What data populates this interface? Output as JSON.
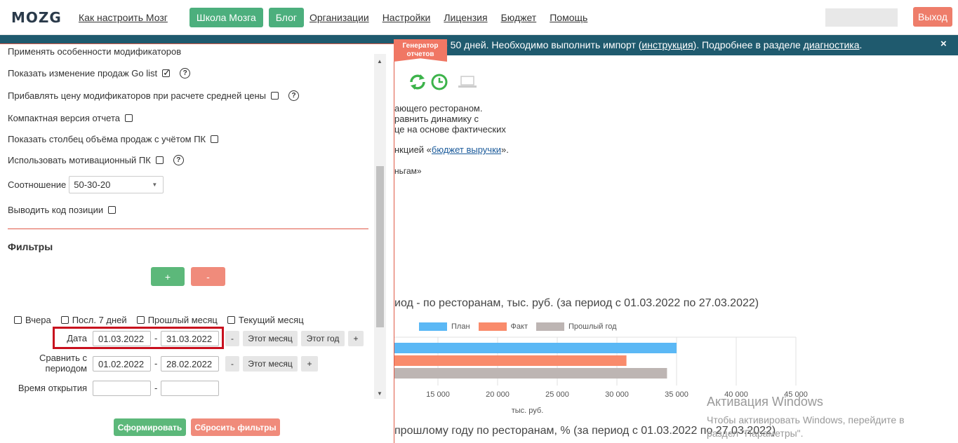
{
  "header": {
    "logo": "MOZG",
    "nav_how": "Как настроить Мозг",
    "school": "Школа Мозга",
    "blog": "Блог",
    "links": [
      "Организации",
      "Настройки",
      "Лицензия",
      "Бюджет",
      "Помощь"
    ],
    "logout": "Выход"
  },
  "banner": {
    "pre": "ё 50 дней. Необходимо выполнить импорт (",
    "link1": "инструкция",
    "mid": "). Подробнее в разделе ",
    "link2": "диагностика",
    "post": ".",
    "close": "×"
  },
  "ribbon": {
    "line1": "Генератор",
    "line2": "отчетов"
  },
  "background": {
    "desc1": "ающего рестораном.",
    "desc2": "равнить динамику с",
    "desc3": "це на основе фактических",
    "desc4_pre": "нкцией «",
    "desc4_link": "бюджет выручки",
    "desc4_post": "».",
    "desc5": "ньгам»",
    "chart_title": "иод - по ресторанам, тыс. руб. (за период с 01.03.2022 по 27.03.2022)",
    "chart2_title": "прошлому году по ресторанам, % (за период с 01.03.2022 по 27.03.2022)",
    "axis_label": "тыс. руб."
  },
  "chart_data": {
    "type": "bar",
    "orientation": "horizontal",
    "series": [
      {
        "name": "План",
        "values": [
          35000
        ],
        "color": "#5bb8f5"
      },
      {
        "name": "Факт",
        "values": [
          30800
        ],
        "color": "#f98b6b"
      },
      {
        "name": "Прошлый год",
        "values": [
          34200
        ],
        "color": "#bdb5b3"
      }
    ],
    "x_ticks": [
      "15 000",
      "20 000",
      "25 000",
      "30 000",
      "35 000",
      "40 000",
      "45 000"
    ],
    "xlabel": "тыс. руб.",
    "legend_position": "top",
    "grid": true
  },
  "panel": {
    "row_top": "Применять особенности модификаторов",
    "go_list": "Показать изменение продаж Go list",
    "add_price": "Прибавлять цену модификаторов при расчете средней цены",
    "compact": "Компактная версия отчета",
    "volume_col": "Показать столбец объёма продаж с учётом ПК",
    "motiv": "Использовать мотивационный ПК",
    "ratio_label": "Соотношение",
    "ratio_value": "50-30-20",
    "pos_code": "Выводить код позиции",
    "filters": "Фильтры",
    "plus": "+",
    "minus": "-",
    "quick": [
      "Вчера",
      "Посл. 7 дней",
      "Прошлый месяц",
      "Текущий месяц"
    ],
    "date_label": "Дата",
    "date_from": "01.03.2022",
    "date_to": "31.03.2022",
    "compare_label1": "Сравнить с",
    "compare_label2": "периодом",
    "cmp_from": "01.02.2022",
    "cmp_to": "28.02.2022",
    "open_time": "Время открытия",
    "this_month": "Этот месяц",
    "this_year": "Этот год",
    "dash": "-",
    "small_minus": "-",
    "small_plus": "+",
    "submit": "Сформировать",
    "reset": "Сбросить фильтры"
  },
  "windows": {
    "line1": "Активация Windows",
    "line2": "Чтобы активировать Windows, перейдите в",
    "line3": "раздел \"Параметры\"."
  }
}
